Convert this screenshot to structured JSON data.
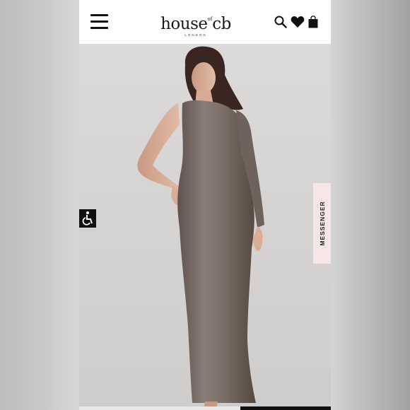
{
  "header": {
    "brand_main": "house of cb",
    "brand_sub": "LONDON"
  },
  "icons": {
    "menu": "hamburger-menu-icon",
    "search": "search-icon",
    "wishlist": "heart-icon",
    "bag": "shopping-bag-icon",
    "accessibility": "accessibility-icon"
  },
  "product_image": {
    "dress_color": "#7a6c66"
  },
  "messenger_tab": {
    "label": "MESSENGER"
  },
  "colors": {
    "header_bg": "#ffffff",
    "messenger_bg": "#f6e6e6",
    "accessibility_bg": "#111111"
  }
}
